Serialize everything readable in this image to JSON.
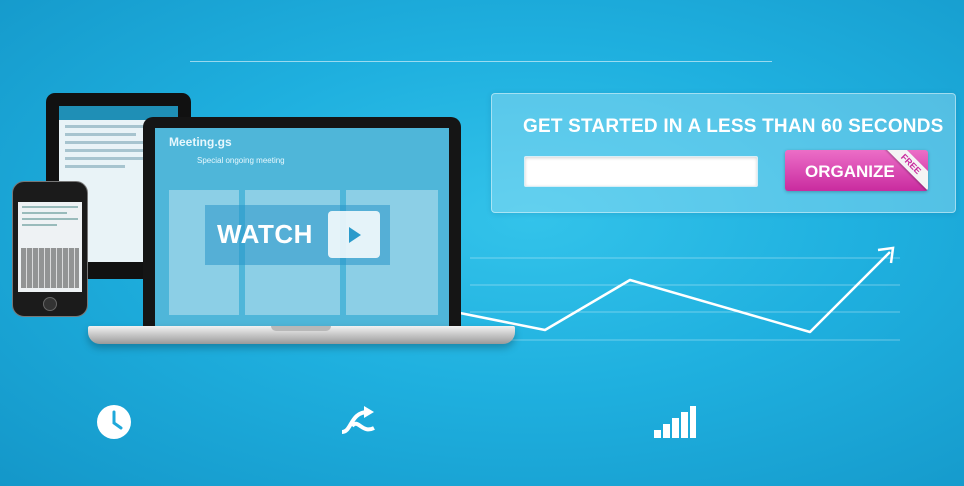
{
  "signup": {
    "heading": "GET STARTED IN A LESS THAN 60 SECONDS",
    "email_value": "",
    "email_placeholder": "",
    "organize_label": "ORGANIZE",
    "free_badge": "FREE"
  },
  "video": {
    "watch_label": "WATCH"
  },
  "laptop_screen": {
    "logo": "Meeting.gs",
    "meeting_title": "Special ongoing meeting"
  },
  "icons": [
    "clock-icon",
    "arrows-icon",
    "signal-bars-icon",
    "play-icon",
    "trend-line-icon"
  ],
  "colors": {
    "background": "#1fb0df",
    "accent_pink": "#d93ab0",
    "white": "#ffffff"
  }
}
